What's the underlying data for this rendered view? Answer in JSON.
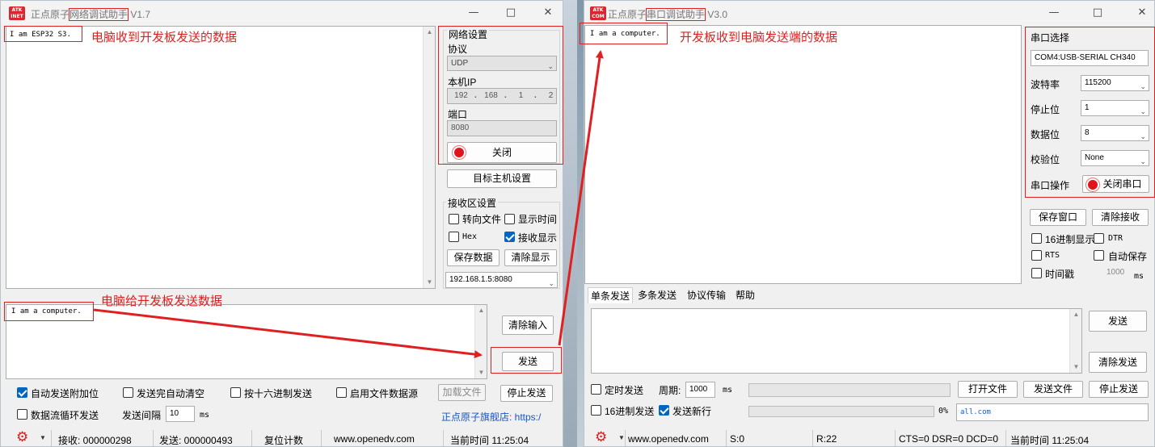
{
  "left": {
    "logo": "ATK\nINET",
    "title_prefix": "正点原子",
    "title_main": "网络调试助手",
    "title_version": "V1.7",
    "recv_text": "I am ESP32 S3.",
    "annot_recv": "电脑收到开发板发送的数据",
    "annot_send": "电脑给开发板发送数据",
    "net_group_title": "网络设置",
    "protocol_label": "协议",
    "protocol_value": "UDP",
    "local_ip_label": "本机IP",
    "ip": [
      "192",
      "168",
      "1",
      "2"
    ],
    "port_label": "端口",
    "port_value": "8080",
    "close_btn": "关闭",
    "target_btn": "目标主机设置",
    "recv_group_title": "接收区设置",
    "to_file": "转向文件",
    "show_time": "显示时间",
    "hex": "Hex",
    "recv_show": "接收显示",
    "save_data": "保存数据",
    "clear_show": "清除显示",
    "target_value": "192.168.1.5:8080",
    "send_text": "I am a computer.",
    "clear_input": "清除输入",
    "send_btn": "发送",
    "auto_add": "自动发送附加位",
    "auto_clear": "发送完自动清空",
    "hex_send": "按十六进制发送",
    "file_source": "启用文件数据源",
    "load_file": "加载文件",
    "stop_send": "停止发送",
    "loop_send": "数据流循环发送",
    "interval_label": "发送间隔",
    "interval_value": "10",
    "ms": "ms",
    "store_link": "正点原子旗舰店: https:/",
    "status_recv": "接收: 000000298",
    "status_send": "发送: 000000493",
    "status_reset": "复位计数",
    "status_site": "www.openedv.com",
    "status_time": "当前时间 11:25:04"
  },
  "right": {
    "logo": "ATK\nCOM",
    "title_prefix": "正点原子",
    "title_main": "串口调试助手",
    "title_version": "V3.0",
    "recv_text": "I am a computer.",
    "annot_recv": "开发板收到电脑发送端的数据",
    "port_select_label": "串口选择",
    "port_select_value": "COM4:USB-SERIAL CH340",
    "baud_label": "波特率",
    "baud_value": "115200",
    "stop_label": "停止位",
    "stop_value": "1",
    "data_label": "数据位",
    "data_value": "8",
    "parity_label": "校验位",
    "parity_value": "None",
    "op_label": "串口操作",
    "close_port_btn": "关闭串口",
    "save_window": "保存窗口",
    "clear_recv": "清除接收",
    "hex_show": "16进制显示",
    "dtr": "DTR",
    "rts": "RTS",
    "auto_save": "自动保存",
    "timestamp": "时间戳",
    "timestamp_value": "1000",
    "ms": "ms",
    "tabs": [
      "单条发送",
      "多条发送",
      "协议传输",
      "帮助"
    ],
    "send_btn": "发送",
    "clear_send": "清除发送",
    "timed_send": "定时发送",
    "period_label": "周期:",
    "period_value": "1000",
    "open_file": "打开文件",
    "send_file": "发送文件",
    "stop_send": "停止发送",
    "hex_send": "16进制发送",
    "newline_send": "发送新行",
    "progress_value": 0,
    "progress_text": "0%",
    "link_text": "all.com",
    "status_site": "www.openedv.com",
    "status_s": "S:0",
    "status_r": "R:22",
    "status_lines": "CTS=0 DSR=0 DCD=0",
    "status_time": "当前时间 11:25:04"
  },
  "colors": {
    "accent": "#0067c0",
    "annotation": "#e02020",
    "led": "#e0141b",
    "progress": "#06b025"
  }
}
